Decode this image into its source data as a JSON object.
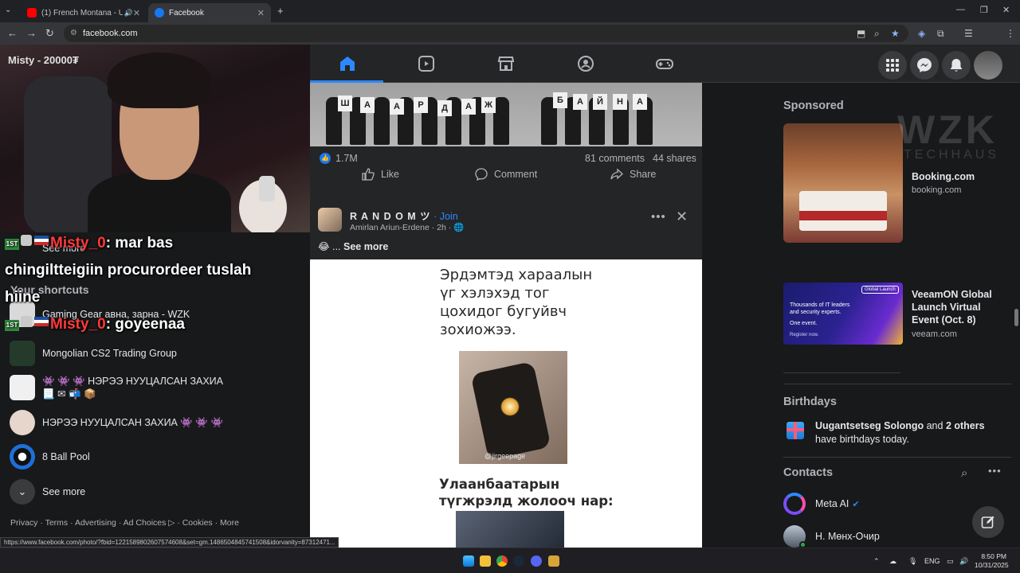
{
  "browser": {
    "tabs": [
      {
        "label": "(1) French Montana - Unfor",
        "active": false
      },
      {
        "label": "Facebook",
        "active": true
      }
    ],
    "url": "facebook.com",
    "status_link": "https://www.facebook.com/photo/?fbid=1221589802607574608&set=gm.1486504845741508&idorvanity=87312471..."
  },
  "stream": {
    "title": "Misty - 20000₮",
    "chat": [
      {
        "name": "Misty_0",
        "text": ": mar bas"
      },
      {
        "text": "chingiltteigiin procurordeer tuslah"
      },
      {
        "text": "hiine"
      },
      {
        "name": "Misty_0",
        "text": ": goyeenaa"
      }
    ]
  },
  "sidebar": {
    "see_more_top": "See more",
    "shortcuts_heading": "Your shortcuts",
    "shortcuts": [
      {
        "label": "Gaming Gear авна, зарна - WZK",
        "thumb_color": "#d9d9d9"
      },
      {
        "label": "Mongolian CS2 Trading Group",
        "thumb_color": "#243b2c"
      },
      {
        "label": "👾 👾 👾 НЭРЭЭ НУУЦАЛСАН ЗАХИА 📃 ✉ 📬 📦",
        "thumb_color": "#f0f0f0"
      },
      {
        "label": "НЭРЭЭ НУУЦАЛСАН ЗАХИА 👾 👾 👾",
        "thumb_color": "#e6d6cc"
      },
      {
        "label": "8 Ball Pool",
        "thumb_color": "#1e6fd9"
      }
    ],
    "see_more_bottom": "See more",
    "footer": [
      "Privacy",
      "Terms",
      "Advertising",
      "Ad Choices",
      "Cookies",
      "More"
    ]
  },
  "feed": {
    "post1": {
      "sign_letters": [
        "Ш",
        "А",
        "А",
        "Р",
        "Д",
        "А",
        "Ж",
        "Б",
        "А",
        "Й",
        "Н",
        "А"
      ],
      "reactions": "1.7M",
      "comments": "81 comments",
      "shares": "44 shares",
      "actions": {
        "like": "Like",
        "comment": "Comment",
        "share": "Share"
      }
    },
    "post2": {
      "group": "R A N D O M ツ",
      "join": "Join",
      "author": "Amirlan Ariun-Erdene",
      "time": "2h",
      "see_more": "See more",
      "emoji": "😂",
      "image_text_1": [
        "Эрдэмтэд хараалын",
        "үг хэлэхэд тог",
        "цохидог бугуйвч",
        "зохиожээ."
      ],
      "watermark": "@jirgeepage",
      "image_text_2": [
        "Улаанбаатарын",
        "түгжрэлд жолооч нар:"
      ]
    }
  },
  "right": {
    "sponsored": "Sponsored",
    "ads": [
      {
        "name": "Booking.com",
        "domain": "booking.com"
      },
      {
        "name": "VeeamON Global Launch Virtual Event (Oct. 8)",
        "domain": "veeam.com",
        "banner_title": "Global Launch",
        "banner_lines": [
          "Thousands of IT leaders",
          "and security experts."
        ],
        "banner_event": "One event.",
        "banner_cta": "Register now."
      }
    ],
    "wzk_overlay": "WZK",
    "wzk_sub": "TECHHAUS",
    "birthdays_heading": "Birthdays",
    "birthday_name": "Uugantsetseg Solongo",
    "birthday_and": " and ",
    "birthday_others": "2 others",
    "birthday_rest": " have birthdays today.",
    "contacts_heading": "Contacts",
    "contacts": [
      {
        "name": "Meta AI"
      },
      {
        "name": "Н. Мөнх-Очир"
      }
    ]
  },
  "taskbar": {
    "lang": "ENG",
    "time": "8:50 PM",
    "date": "10/31/2025"
  },
  "colors": {
    "accent": "#2d88ff",
    "bg": "#18191a",
    "card": "#242526",
    "chat_name": "#ff3a3a"
  }
}
